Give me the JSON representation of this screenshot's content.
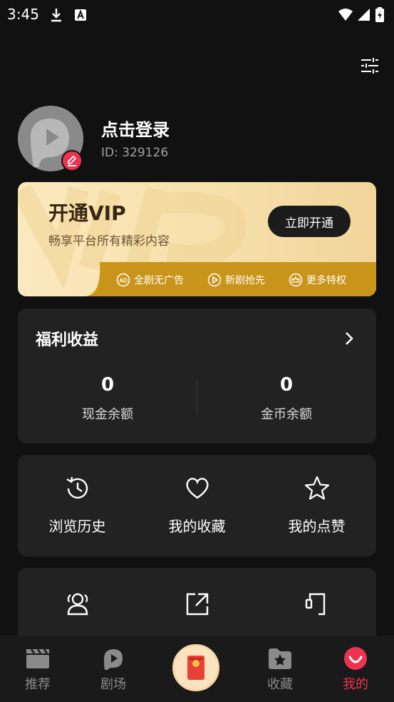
{
  "status_bar": {
    "time": "3:45",
    "icons": [
      "download-icon",
      "a-icon",
      "wifi-icon",
      "signal-icon",
      "battery-icon"
    ]
  },
  "header": {
    "settings_icon": "sliders-icon"
  },
  "profile": {
    "login_label": "点击登录",
    "user_id": "ID: 329126"
  },
  "vip": {
    "title": "开通VIP",
    "subtitle": "畅享平台所有精彩内容",
    "button_label": "立即开通",
    "perks": [
      {
        "label": "全剧无广告",
        "icon": "ad-icon"
      },
      {
        "label": "新剧抢先",
        "icon": "play-icon"
      },
      {
        "label": "更多特权",
        "icon": "crown-icon"
      }
    ]
  },
  "welfare": {
    "title": "福利收益",
    "stats": [
      {
        "value": "0",
        "label": "现金余额"
      },
      {
        "value": "0",
        "label": "金币余额"
      }
    ]
  },
  "shortcuts": [
    {
      "label": "浏览历史",
      "icon": "history-icon"
    },
    {
      "label": "我的收藏",
      "icon": "heart-icon"
    },
    {
      "label": "我的点赞",
      "icon": "star-icon"
    }
  ],
  "more_items": [
    {
      "icon": "users-icon"
    },
    {
      "icon": "share-icon"
    },
    {
      "icon": "headset-icon"
    }
  ],
  "nav": {
    "items": [
      {
        "label": "推荐",
        "icon": "clapper-icon"
      },
      {
        "label": "剧场",
        "icon": "theater-icon"
      },
      {
        "label": "收藏",
        "icon": "folder-star-icon"
      },
      {
        "label": "我的",
        "icon": "smile-icon"
      }
    ],
    "active_color": "#ee3350"
  },
  "colors": {
    "accent": "#ee3350",
    "vip_gold": "#c8951a",
    "background": "#111111",
    "card": "#222222"
  }
}
